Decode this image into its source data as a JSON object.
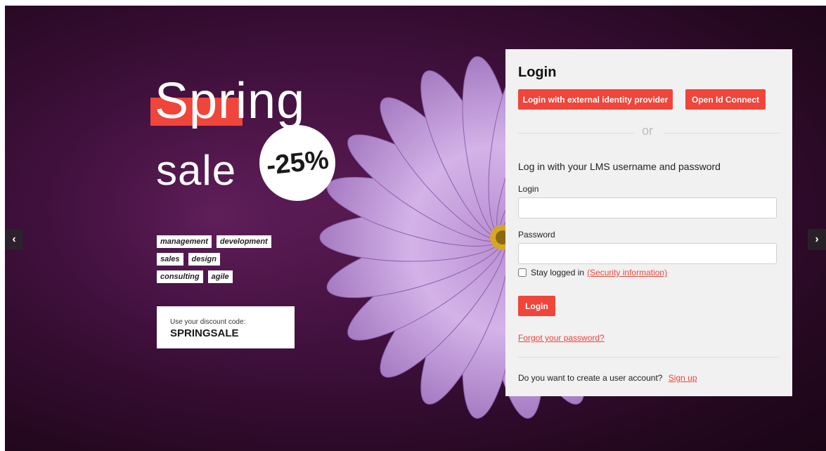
{
  "promo": {
    "title_line1": "Spring",
    "title_line2": "sale",
    "discount": "-25%",
    "tags": [
      [
        "management",
        "development"
      ],
      [
        "sales",
        "design"
      ],
      [
        "consulting",
        "agile"
      ]
    ],
    "code_label": "Use your discount code:",
    "code_value": "SPRINGSALE"
  },
  "carousel": {
    "prev_icon": "‹",
    "next_icon": "›"
  },
  "login": {
    "title": "Login",
    "external_button": "Login with external identity provider",
    "openid_button": "Open Id Connect",
    "or_text": "or",
    "subheading": "Log in with your LMS username and password",
    "login_label": "Login",
    "login_value": "",
    "password_label": "Password",
    "password_value": "",
    "stay_logged_in": "Stay logged in",
    "security_link": "(Security information)",
    "login_button": "Login",
    "forgot_link": "Forgot your password?",
    "create_account_text": "Do you want to create a user account?",
    "signup_link": "Sign up"
  },
  "colors": {
    "accent": "#f0453a",
    "panel_bg": "#f1f1f1",
    "background": "#3d0f3a"
  },
  "icons": {
    "prev": "chevron-left-icon",
    "next": "chevron-right-icon"
  }
}
